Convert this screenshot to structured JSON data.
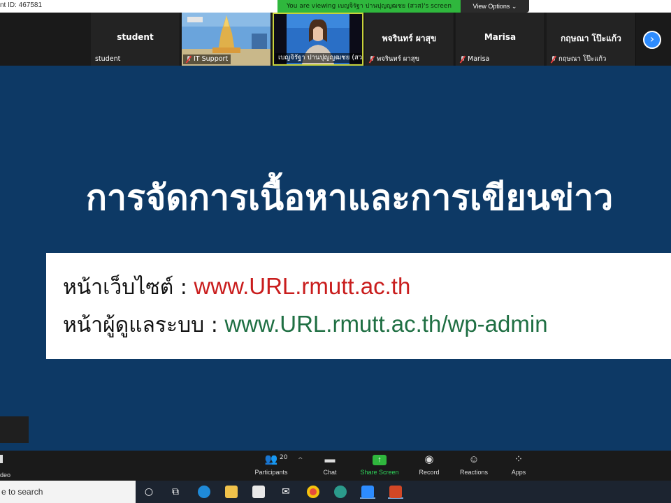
{
  "topbar": {
    "meeting_id": "nt ID: 467581",
    "viewing_banner": "You are viewing เบญจิรัฐา ปานปุญญฒชย (สวส)'s screen",
    "view_options": "View Options ⌄"
  },
  "participants_strip": [
    {
      "name": "student",
      "label": "student",
      "muted": false
    },
    {
      "name": "",
      "label": "IT Support",
      "muted": true
    },
    {
      "name": "",
      "label": "เบญจิรัฐา ปานปุญญฒชย (สวส)",
      "muted": false,
      "active": true
    },
    {
      "name": "พจรินทร์ ผาสุข",
      "label": "พจรินทร์ ผาสุข",
      "muted": true
    },
    {
      "name": "Marisa",
      "label": "Marisa",
      "muted": true
    },
    {
      "name": "กฤษณา โป๊ะแก้ว",
      "label": "กฤษณา โป๊ะแก้ว",
      "muted": true
    }
  ],
  "slide": {
    "title": "การจัดการเนื้อหาและการเขียนข่าว",
    "row1_label": "หน้าเว็บไซต์  :",
    "row1_url": "www.URL.rmutt.ac.th",
    "row2_label": "หน้าผู้ดูแลระบบ :",
    "row2_url": "www.URL.rmutt.ac.th/wp-admin"
  },
  "controls": {
    "video_partial": "deo",
    "participants_label": "Participants",
    "participants_count": "20",
    "chat_label": "Chat",
    "share_label": "Share Screen",
    "record_label": "Record",
    "reactions_label": "Reactions",
    "apps_label": "Apps"
  },
  "taskbar": {
    "search_placeholder": "e to search"
  },
  "colors": {
    "slide_bg": "#0d3965",
    "url_red": "#c91d1d",
    "url_green": "#1f6f43",
    "zoom_green": "#2fb73d",
    "zoom_blue": "#2d8cff"
  }
}
